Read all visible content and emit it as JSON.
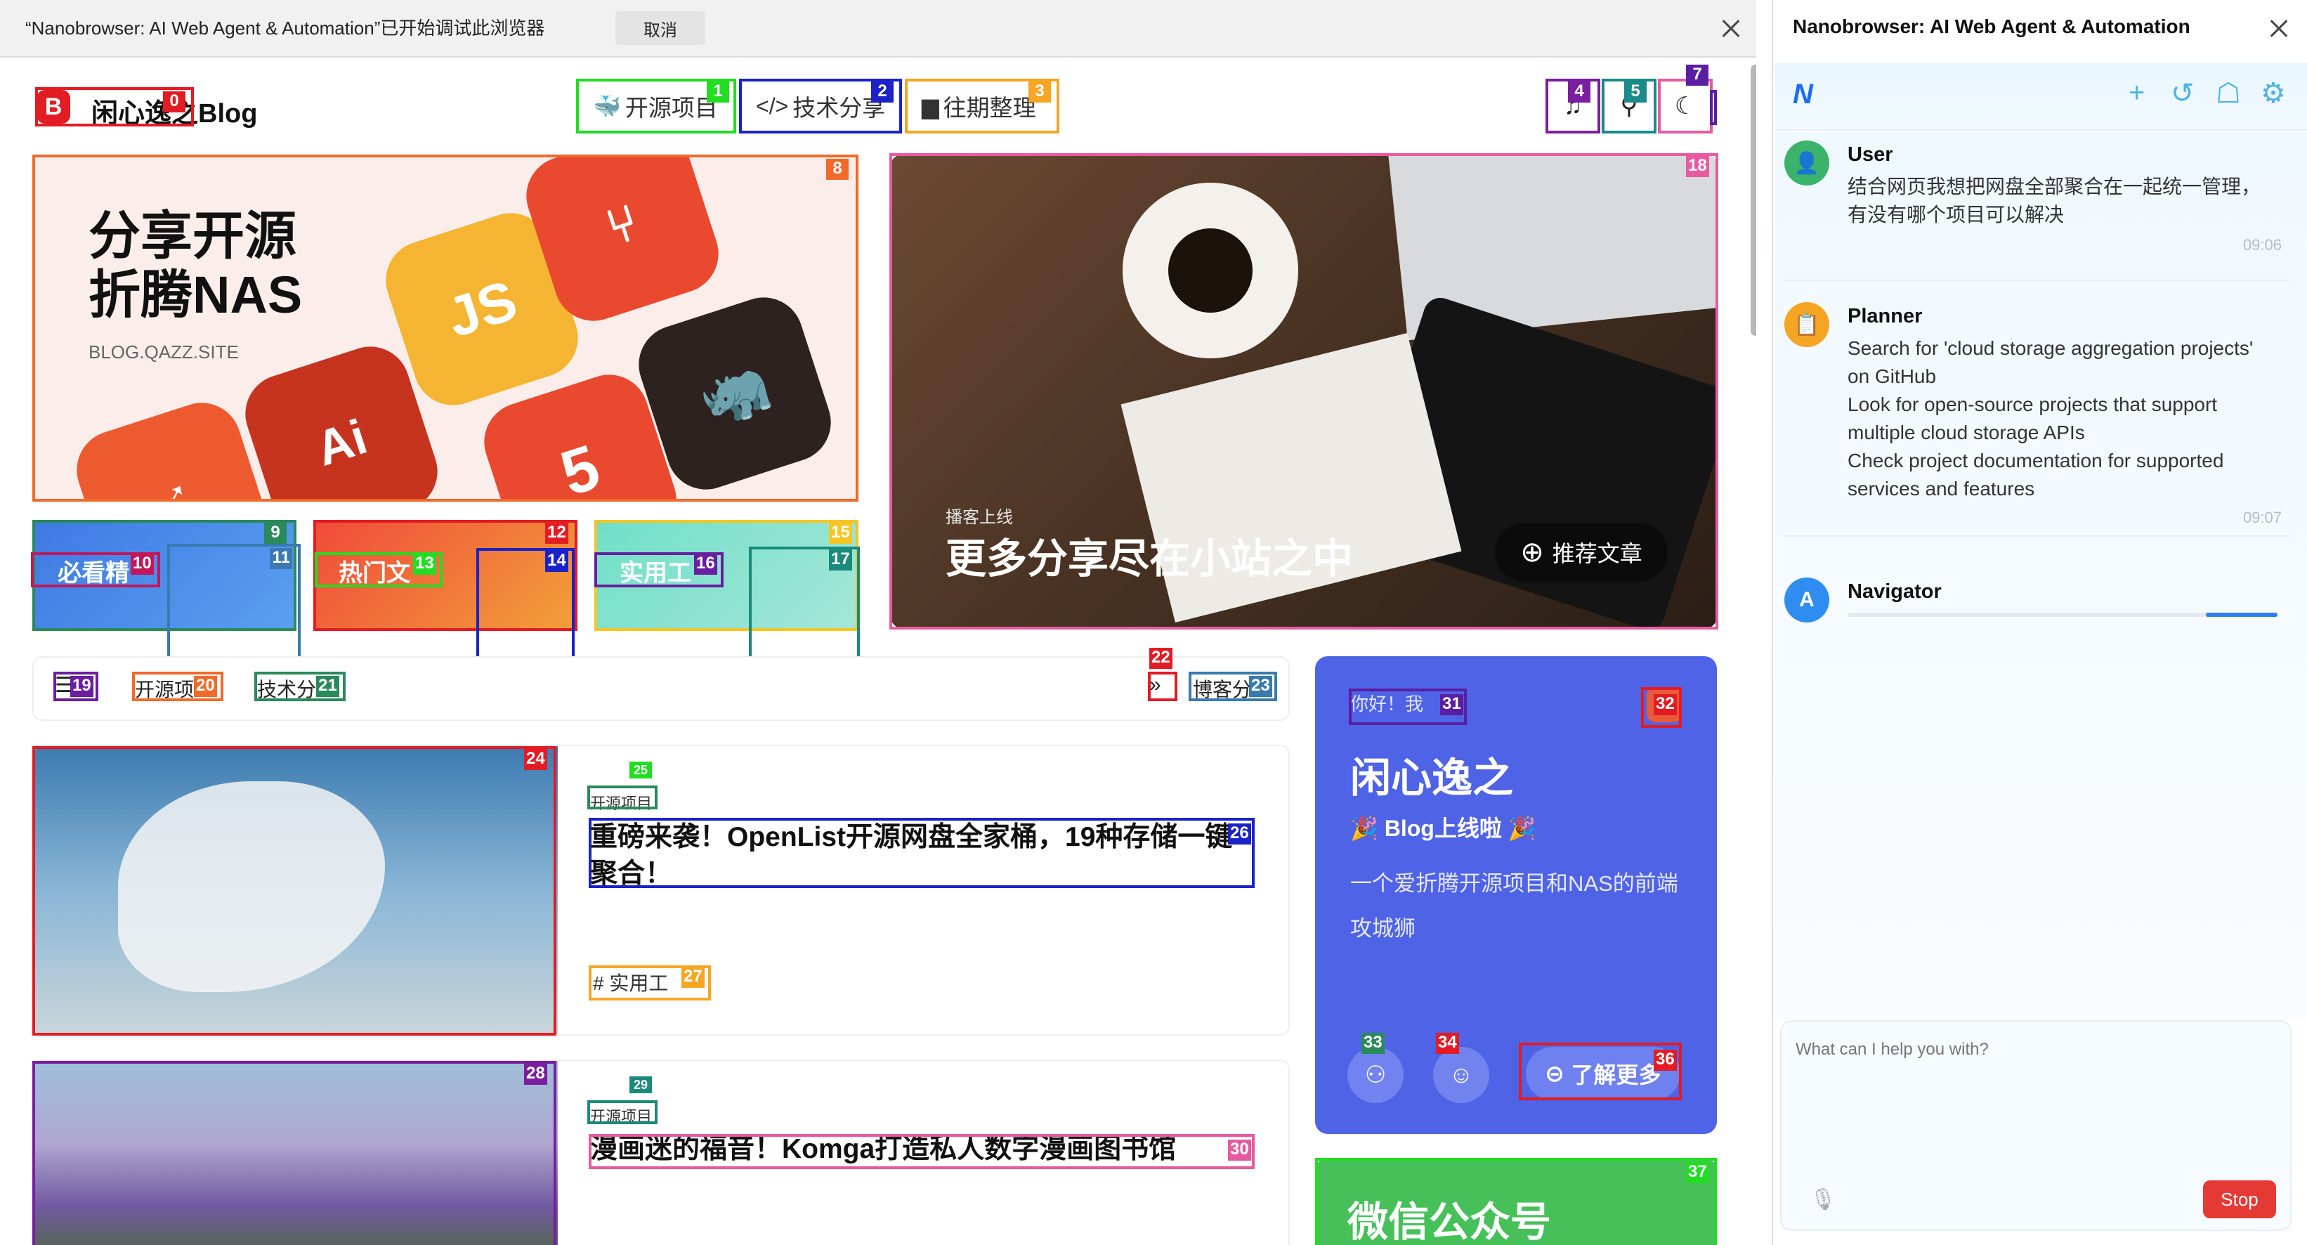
{
  "debug_bar": {
    "message": "“Nanobrowser: AI Web Agent & Automation”已开始调试此浏览器",
    "cancel_label": "取消"
  },
  "site": {
    "brand": "闲心逸之Blog",
    "brand_logo": "B",
    "nav": [
      {
        "label": "开源项目",
        "icon": "docker-icon"
      },
      {
        "label": "技术分享",
        "icon": "code-icon"
      },
      {
        "label": "往期整理",
        "icon": "archive-icon"
      }
    ],
    "tools": [
      "music-icon",
      "search-icon",
      "moon-icon"
    ],
    "banner": {
      "title_line1": "分享开源",
      "title_line2": "折腾NAS",
      "subtitle": "BLOG.QAZZ.SITE",
      "tiles": [
        "Ai",
        "JS",
        "5"
      ]
    },
    "feature": {
      "small": "播客上线",
      "title": "更多分享尽在小站之中",
      "button": "推荐文章"
    },
    "categories": [
      "必看精",
      "热门文",
      "实用工"
    ],
    "filters": [
      "开源项",
      "技术分",
      "博客分"
    ],
    "posts": [
      {
        "tag": "开源项目",
        "title": "重磅来袭！OpenList开源网盘全家桶，19种存储一键聚合！",
        "chip": "# 实用工"
      },
      {
        "tag": "开源项目",
        "title": "漫画迷的福音！Komga打造私人数字漫画图书馆"
      }
    ],
    "profile": {
      "greeting": "你好！我",
      "name": "闲心逸之",
      "blog": "🎉 Blog上线啦 🎉",
      "desc": "一个爱折腾开源项目和NAS的前端攻城狮",
      "more": "了解更多"
    },
    "wechat_title": "微信公众号"
  },
  "labels": [
    "0",
    "1",
    "2",
    "3",
    "4",
    "5",
    "7",
    "8",
    "9",
    "10",
    "11",
    "12",
    "13",
    "14",
    "15",
    "16",
    "17",
    "18",
    "19",
    "20",
    "21",
    "22",
    "23",
    "24",
    "25",
    "26",
    "27",
    "28",
    "29",
    "30",
    "31",
    "32",
    "33",
    "34",
    "36",
    "37"
  ],
  "sidepanel": {
    "title": "Nanobrowser: AI Web Agent & Automation",
    "logo": "N",
    "messages": [
      {
        "name": "User",
        "text_line1": "结合网页我想把网盘全部聚合在一起统一管理，",
        "text_line2": "有没有哪个项目可以解决",
        "time": "09:06"
      },
      {
        "name": "Planner",
        "text_line1": "Search for 'cloud storage aggregation projects'",
        "text_line2": "on GitHub",
        "text_line3": "Look for open-source projects that support",
        "text_line4": "multiple cloud storage APIs",
        "text_line5": "Check project documentation for supported",
        "text_line6": "services and features",
        "time": "09:07"
      },
      {
        "name": "Navigator",
        "avatar": "A"
      }
    ],
    "input_placeholder": "What can I help you with?",
    "stop_label": "Stop"
  },
  "colors": {
    "accent": "#4f63e6",
    "stop": "#e53935",
    "user_avatar": "#3bb36a",
    "planner_avatar": "#f5a524",
    "navigator_avatar": "#2f8df2"
  }
}
